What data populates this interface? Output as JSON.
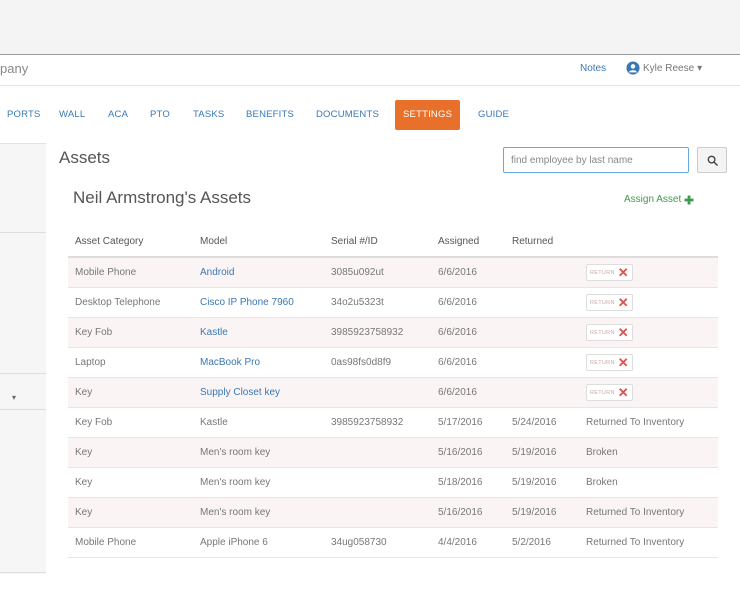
{
  "header": {
    "company_partial": "pany",
    "notes_label": "Notes",
    "user_name": "Kyle Reese",
    "user_caret": "▾"
  },
  "nav": {
    "items": [
      {
        "label": "PORTS",
        "active": false
      },
      {
        "label": "WALL",
        "active": false
      },
      {
        "label": "ACA",
        "active": false
      },
      {
        "label": "PTO",
        "active": false
      },
      {
        "label": "TASKS",
        "active": false
      },
      {
        "label": "BENEFITS",
        "active": false
      },
      {
        "label": "DOCUMENTS",
        "active": false
      },
      {
        "label": "SETTINGS",
        "active": true
      },
      {
        "label": "GUIDE",
        "active": false
      }
    ]
  },
  "page": {
    "title": "Assets",
    "search_placeholder": "find employee by last name",
    "subtitle": "Neil Armstrong's Assets",
    "assign_label": "Assign Asset"
  },
  "sidebar": {
    "caret": "▾"
  },
  "colors": {
    "accent": "#e8702a",
    "link": "#3a78b5",
    "assign_green": "#3d9c4a",
    "remove_red": "#d9534f"
  },
  "table": {
    "headers": [
      "Asset Category",
      "Model",
      "Serial #/ID",
      "Assigned",
      "Returned",
      ""
    ],
    "return_label": "RETURN",
    "rows": [
      {
        "category": "Mobile Phone",
        "model": "Android",
        "serial": "3085u092ut",
        "assigned": "6/6/2016",
        "returned": "",
        "status": "",
        "model_link": true,
        "returnable": true
      },
      {
        "category": "Desktop Telephone",
        "model": "Cisco IP Phone 7960",
        "serial": "34o2u5323t",
        "assigned": "6/6/2016",
        "returned": "",
        "status": "",
        "model_link": true,
        "returnable": true
      },
      {
        "category": "Key Fob",
        "model": "Kastle",
        "serial": "3985923758932",
        "assigned": "6/6/2016",
        "returned": "",
        "status": "",
        "model_link": true,
        "returnable": true
      },
      {
        "category": "Laptop",
        "model": "MacBook Pro",
        "serial": "0as98fs0d8f9",
        "assigned": "6/6/2016",
        "returned": "",
        "status": "",
        "model_link": true,
        "returnable": true
      },
      {
        "category": "Key",
        "model": "Supply Closet key",
        "serial": "",
        "assigned": "6/6/2016",
        "returned": "",
        "status": "",
        "model_link": true,
        "returnable": true
      },
      {
        "category": "Key Fob",
        "model": "Kastle",
        "serial": "3985923758932",
        "assigned": "5/17/2016",
        "returned": "5/24/2016",
        "status": "Returned To Inventory",
        "model_link": false,
        "returnable": false
      },
      {
        "category": "Key",
        "model": "Men's room key",
        "serial": "",
        "assigned": "5/16/2016",
        "returned": "5/19/2016",
        "status": "Broken",
        "model_link": false,
        "returnable": false
      },
      {
        "category": "Key",
        "model": "Men's room key",
        "serial": "",
        "assigned": "5/18/2016",
        "returned": "5/19/2016",
        "status": "Broken",
        "model_link": false,
        "returnable": false
      },
      {
        "category": "Key",
        "model": "Men's room key",
        "serial": "",
        "assigned": "5/16/2016",
        "returned": "5/19/2016",
        "status": "Returned To Inventory",
        "model_link": false,
        "returnable": false
      },
      {
        "category": "Mobile Phone",
        "model": "Apple iPhone 6",
        "serial": "34ug058730",
        "assigned": "4/4/2016",
        "returned": "5/2/2016",
        "status": "Returned To Inventory",
        "model_link": false,
        "returnable": false
      }
    ]
  }
}
